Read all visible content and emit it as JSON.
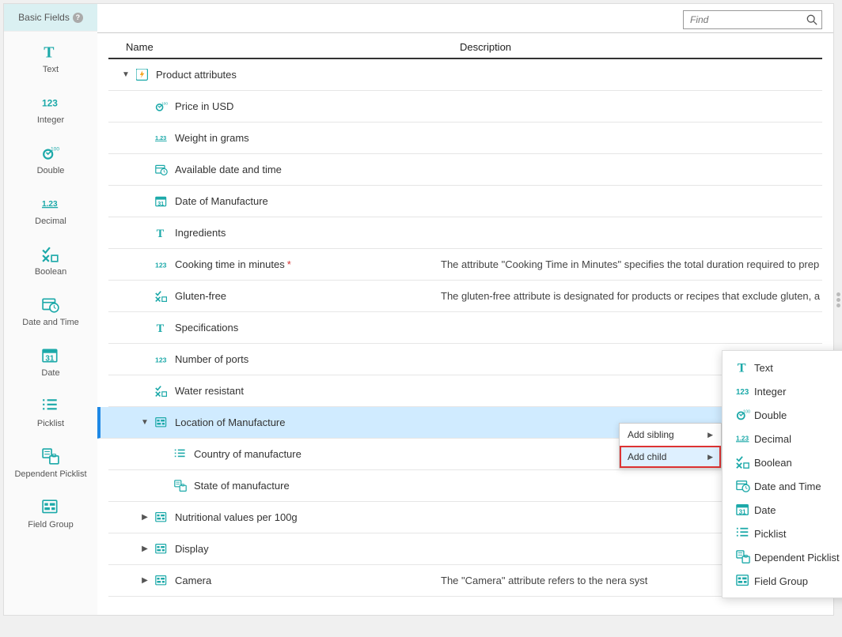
{
  "sidebar": {
    "header": "Basic Fields",
    "items": [
      {
        "label": "Text",
        "icon": "text"
      },
      {
        "label": "Integer",
        "icon": "integer"
      },
      {
        "label": "Double",
        "icon": "double"
      },
      {
        "label": "Decimal",
        "icon": "decimal"
      },
      {
        "label": "Boolean",
        "icon": "boolean"
      },
      {
        "label": "Date and Time",
        "icon": "datetime"
      },
      {
        "label": "Date",
        "icon": "date"
      },
      {
        "label": "Picklist",
        "icon": "picklist"
      },
      {
        "label": "Dependent Picklist",
        "icon": "dependent"
      },
      {
        "label": "Field Group",
        "icon": "fieldgroup"
      }
    ]
  },
  "search": {
    "placeholder": "Find"
  },
  "columns": {
    "name": "Name",
    "desc": "Description"
  },
  "rows": [
    {
      "indent": 0,
      "arrow": "down",
      "icon": "bolt",
      "name": "Product attributes",
      "desc": ""
    },
    {
      "indent": 1,
      "arrow": "",
      "icon": "double",
      "name": "Price in USD",
      "desc": ""
    },
    {
      "indent": 1,
      "arrow": "",
      "icon": "decimal",
      "name": "Weight in grams",
      "desc": ""
    },
    {
      "indent": 1,
      "arrow": "",
      "icon": "datetime",
      "name": "Available date and time",
      "desc": ""
    },
    {
      "indent": 1,
      "arrow": "",
      "icon": "date",
      "name": "Date of Manufacture",
      "desc": ""
    },
    {
      "indent": 1,
      "arrow": "",
      "icon": "text",
      "name": "Ingredients",
      "desc": ""
    },
    {
      "indent": 1,
      "arrow": "",
      "icon": "integer",
      "name": "Cooking time in minutes",
      "desc": "The attribute \"Cooking Time in Minutes\" specifies the total duration required to prep",
      "required": true
    },
    {
      "indent": 1,
      "arrow": "",
      "icon": "boolean",
      "name": "Gluten-free",
      "desc": "The gluten-free attribute is designated for products or recipes that exclude gluten, a"
    },
    {
      "indent": 1,
      "arrow": "",
      "icon": "text",
      "name": "Specifications",
      "desc": ""
    },
    {
      "indent": 1,
      "arrow": "",
      "icon": "integer",
      "name": "Number of ports",
      "desc": ""
    },
    {
      "indent": 1,
      "arrow": "",
      "icon": "boolean",
      "name": "Water resistant",
      "desc": ""
    },
    {
      "indent": 1,
      "arrow": "down",
      "icon": "fieldgroup",
      "name": "Location of Manufacture",
      "desc": "",
      "selected": true
    },
    {
      "indent": 2,
      "arrow": "",
      "icon": "picklist",
      "name": "Country of manufacture",
      "desc": ""
    },
    {
      "indent": 2,
      "arrow": "",
      "icon": "dependent",
      "name": "State of manufacture",
      "desc": ""
    },
    {
      "indent": 1,
      "arrow": "right",
      "icon": "fieldgroup",
      "name": "Nutritional values per 100g",
      "desc": ""
    },
    {
      "indent": 1,
      "arrow": "right",
      "icon": "fieldgroup",
      "name": "Display",
      "desc": ""
    },
    {
      "indent": 1,
      "arrow": "right",
      "icon": "fieldgroup",
      "name": "Camera",
      "desc": "The \"Camera\" attribute refers to the                                                                                            nera syst"
    }
  ],
  "context": {
    "items": [
      {
        "label": "Add sibling",
        "hasSub": true,
        "highlight": false
      },
      {
        "label": "Add child",
        "hasSub": true,
        "highlight": true
      }
    ]
  },
  "submenu": {
    "items": [
      {
        "label": "Text",
        "icon": "text"
      },
      {
        "label": "Integer",
        "icon": "integer"
      },
      {
        "label": "Double",
        "icon": "double"
      },
      {
        "label": "Decimal",
        "icon": "decimal"
      },
      {
        "label": "Boolean",
        "icon": "boolean"
      },
      {
        "label": "Date and Time",
        "icon": "datetime"
      },
      {
        "label": "Date",
        "icon": "date"
      },
      {
        "label": "Picklist",
        "icon": "picklist"
      },
      {
        "label": "Dependent Picklist",
        "icon": "dependent"
      },
      {
        "label": "Field Group",
        "icon": "fieldgroup"
      }
    ]
  }
}
